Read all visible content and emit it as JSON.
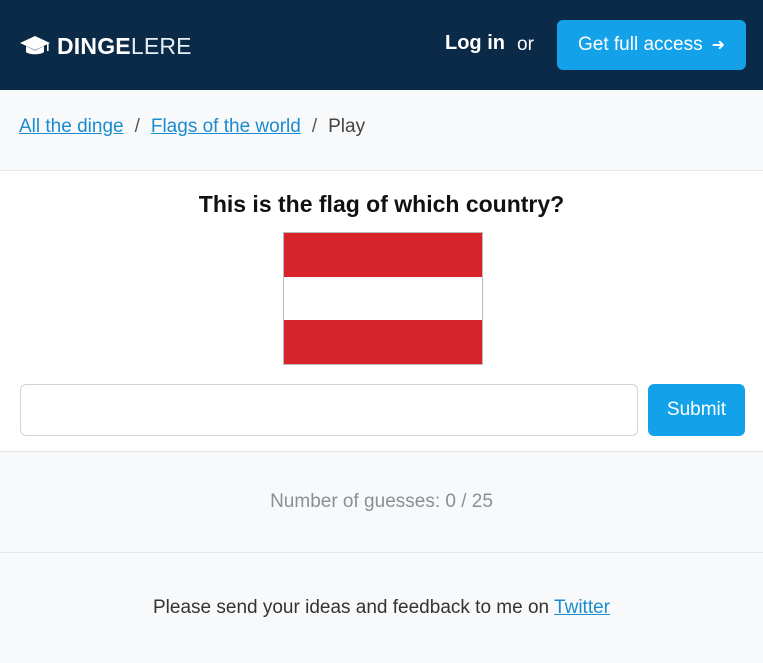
{
  "header": {
    "brand_bold": "DINGE",
    "brand_light": "LERE",
    "login_label": "Log in",
    "or_label": "or",
    "cta_label": "Get full access",
    "cta_arrow": "➜"
  },
  "breadcrumb": {
    "items": [
      "All the dinge",
      "Flags of the world"
    ],
    "separator": "/",
    "current": "Play"
  },
  "quiz": {
    "question": "This is the flag of which country?",
    "flag_colors": [
      "#d7242a",
      "#ffffff",
      "#d7242a"
    ],
    "answer_value": "",
    "answer_placeholder": "",
    "submit_label": "Submit"
  },
  "status": {
    "guesses_text": "Number of guesses: 0 / 25"
  },
  "footer": {
    "text": "Please send your ideas and feedback to me on ",
    "link_label": "Twitter"
  },
  "colors": {
    "navbar": "#0a2a47",
    "accent": "#13a2e9",
    "link": "#1a8ccf"
  },
  "icons": {
    "brand": "graduation-cap-icon",
    "cta": "arrow-right-icon"
  }
}
